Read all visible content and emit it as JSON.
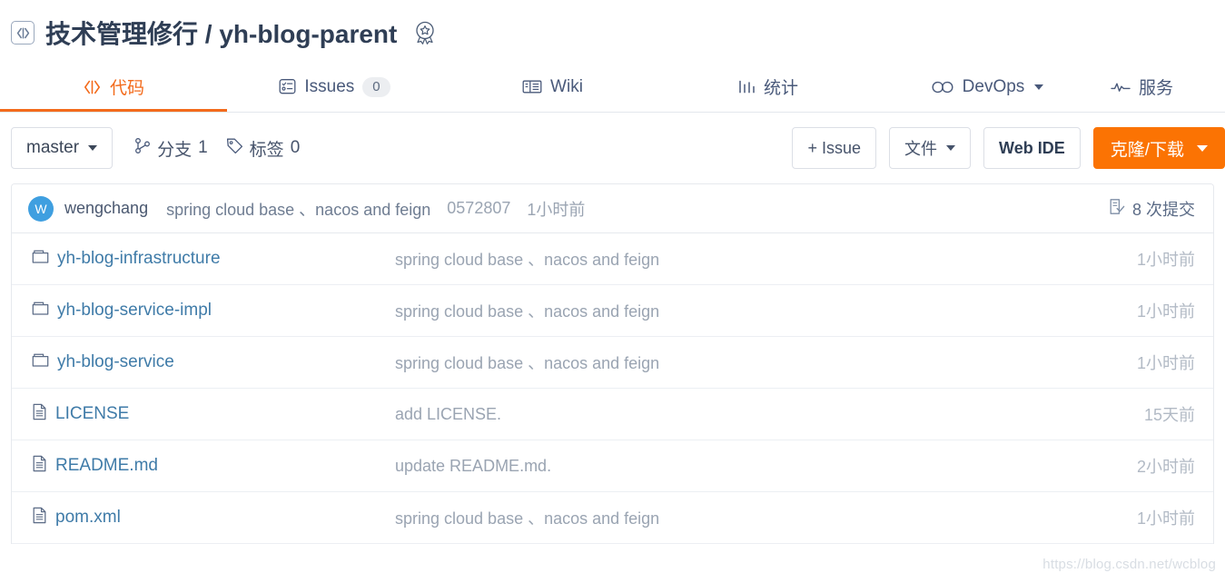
{
  "repo": {
    "owner": "技术管理修行",
    "separator": "/",
    "name": "yh-blog-parent",
    "code_icon": "code-brackets-icon",
    "badge_icon": "award-star-icon"
  },
  "nav": {
    "tabs": [
      {
        "label": "代码",
        "icon": "code-angle-brackets-icon",
        "active": true,
        "badge": null,
        "dropdown": false
      },
      {
        "label": "Issues",
        "icon": "issues-list-icon",
        "active": false,
        "badge": "0",
        "dropdown": false
      },
      {
        "label": "Wiki",
        "icon": "book-icon",
        "active": false,
        "badge": null,
        "dropdown": false
      },
      {
        "label": "统计",
        "icon": "bar-chart-icon",
        "active": false,
        "badge": null,
        "dropdown": false
      },
      {
        "label": "DevOps",
        "icon": "infinity-icon",
        "active": false,
        "badge": null,
        "dropdown": true
      },
      {
        "label": "服务",
        "icon": "pulse-activity-icon",
        "active": false,
        "badge": null,
        "dropdown": false
      }
    ]
  },
  "toolbar": {
    "branch_label": "master",
    "branch_icon": "branch-icon",
    "branches_label": "分支",
    "branches_count": "1",
    "tag_icon": "tag-icon",
    "tags_label": "标签",
    "tags_count": "0",
    "new_issue_label": "+ Issue",
    "files_label": "文件",
    "web_ide_label": "Web IDE",
    "clone_label": "克隆/下载",
    "clone_color": "#fb7303"
  },
  "commit_bar": {
    "avatar_letter": "W",
    "avatar_color": "#3f9fe0",
    "author": "wengchang",
    "message": "spring cloud base 、nacos and feign",
    "sha": "0572807",
    "time": "1小时前",
    "commits_icon": "commit-history-icon",
    "commits_label": "8 次提交"
  },
  "files": [
    {
      "icon": "folder-icon",
      "name": "yh-blog-infrastructure",
      "message": "spring cloud base 、nacos and feign",
      "time": "1小时前"
    },
    {
      "icon": "folder-icon",
      "name": "yh-blog-service-impl",
      "message": "spring cloud base 、nacos and feign",
      "time": "1小时前"
    },
    {
      "icon": "folder-icon",
      "name": "yh-blog-service",
      "message": "spring cloud base 、nacos and feign",
      "time": "1小时前"
    },
    {
      "icon": "file-icon",
      "name": "LICENSE",
      "message": "add LICENSE.",
      "time": "15天前"
    },
    {
      "icon": "file-icon",
      "name": "README.md",
      "message": "update README.md.",
      "time": "2小时前"
    },
    {
      "icon": "file-icon",
      "name": "pom.xml",
      "message": "spring cloud base 、nacos and feign",
      "time": "1小时前"
    }
  ],
  "watermark": "https://blog.csdn.net/wcblog"
}
